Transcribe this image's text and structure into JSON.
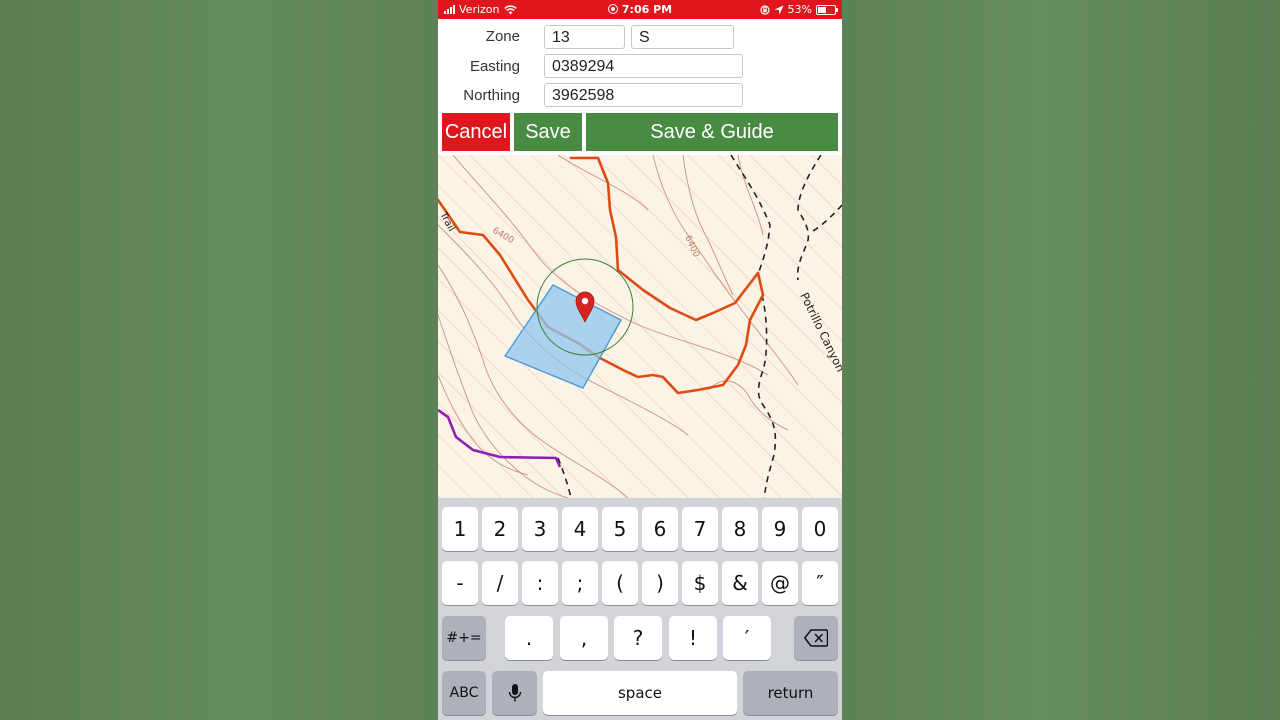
{
  "status_bar": {
    "carrier": "Verizon",
    "time": "7:06 PM",
    "battery": "53%"
  },
  "form": {
    "zone_label": "Zone",
    "zone_number": "13",
    "zone_letter": "S",
    "easting_label": "Easting",
    "easting_value": "0389294",
    "northing_label": "Northing",
    "northing_value": "3962598"
  },
  "buttons": {
    "cancel": "Cancel",
    "save": "Save",
    "save_guide": "Save & Guide"
  },
  "map": {
    "contour_label_1": "6400",
    "contour_label_2": "6400",
    "canyon_label": "Potrillo Canyon",
    "trail_fragment": "Trail",
    "colors": {
      "trail": "#dd4b12",
      "boundary": "#222222",
      "purple_trail": "#8e1fb5",
      "selection_fill": "#93c7ee",
      "selection_stroke": "#4b9ad8",
      "pin": "#d62520",
      "accuracy_circle": "#3b7f3b",
      "contour": "#c9917f"
    }
  },
  "keyboard": {
    "row1": [
      "1",
      "2",
      "3",
      "4",
      "5",
      "6",
      "7",
      "8",
      "9",
      "0"
    ],
    "row2": [
      "-",
      "/",
      ":",
      ";",
      "(",
      ")",
      "$",
      "&",
      "@",
      "″"
    ],
    "row3_mode": "#+=",
    "row3": [
      ".",
      ",",
      "?",
      "!",
      "′"
    ],
    "abc": "ABC",
    "space": "space",
    "return": "return"
  }
}
